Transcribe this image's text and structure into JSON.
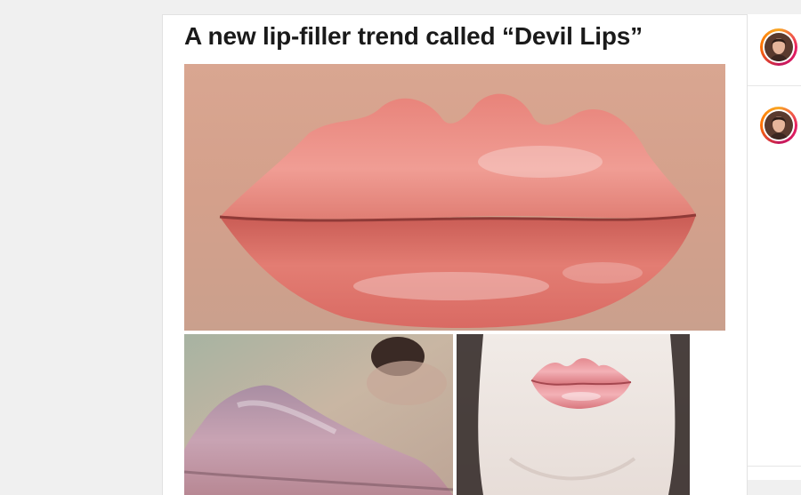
{
  "post": {
    "title": "A new lip-filler trend called “Devil Lips”",
    "images": [
      {
        "name": "lips-closeup-photo"
      },
      {
        "name": "lips-profile-photo"
      },
      {
        "name": "lips-front-photo"
      }
    ]
  },
  "sidebar": {
    "avatars": [
      {
        "name": "story-avatar"
      },
      {
        "name": "story-avatar"
      }
    ]
  },
  "colors": {
    "page_bg": "#f0f0f0",
    "card_bg": "#ffffff",
    "title": "#1a1a1a",
    "story_ring": "#e91e63"
  }
}
